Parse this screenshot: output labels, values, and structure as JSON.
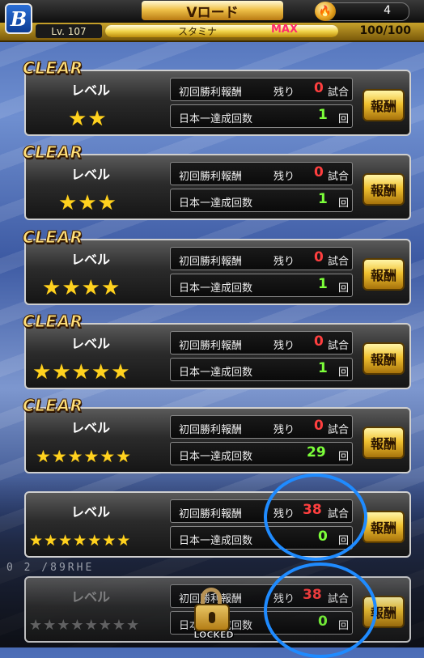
{
  "header": {
    "logo_letter": "B",
    "title": "Vロード",
    "coin_icon": "flame-coin-icon",
    "coins": "4"
  },
  "stamina": {
    "level": "Lv. 107",
    "label": "スタミナ",
    "max_label": "MAX",
    "value": "100/100",
    "fill_fraction": 1.0
  },
  "scoreboard_text": "0 2    /89RHE",
  "labels": {
    "clear": "CLEAR",
    "level": "レベル",
    "first_win_reward": "初回勝利報酬",
    "remaining": "残り",
    "matches_unit": "試合",
    "japan_champion_count": "日本一達成回数",
    "times_unit": "回",
    "reward_button": "報酬",
    "locked": "LOCKED"
  },
  "stages": [
    {
      "stars": 2,
      "cleared": true,
      "remaining": "0",
      "champion_count": "1",
      "locked": false
    },
    {
      "stars": 3,
      "cleared": true,
      "remaining": "0",
      "champion_count": "1",
      "locked": false
    },
    {
      "stars": 4,
      "cleared": true,
      "remaining": "0",
      "champion_count": "1",
      "locked": false
    },
    {
      "stars": 5,
      "cleared": true,
      "remaining": "0",
      "champion_count": "1",
      "locked": false
    },
    {
      "stars": 6,
      "cleared": true,
      "remaining": "0",
      "champion_count": "29",
      "locked": false
    },
    {
      "stars": 7,
      "cleared": false,
      "remaining": "38",
      "champion_count": "0",
      "locked": false
    },
    {
      "stars": 8,
      "cleared": false,
      "remaining": "38",
      "champion_count": "0",
      "locked": true
    }
  ],
  "colors": {
    "remaining_count": "#ff3f3f",
    "champion_count": "#7cff3a",
    "star": "#ffd21f",
    "highlight": "#1f8bff"
  }
}
